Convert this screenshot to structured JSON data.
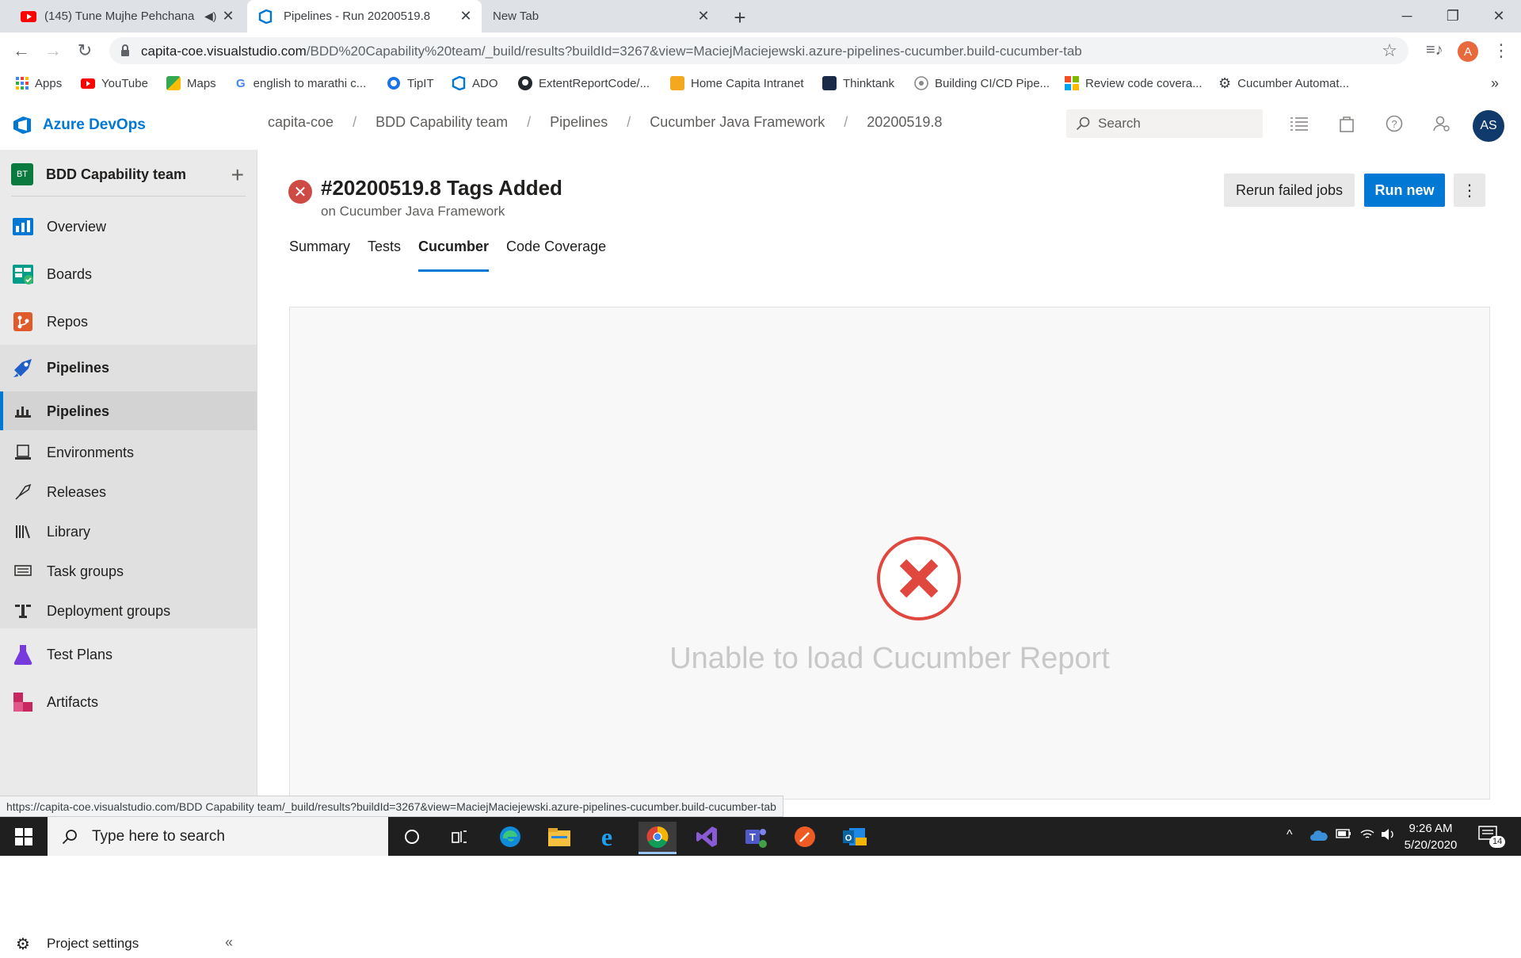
{
  "browser": {
    "tabs": [
      {
        "title": "(145) Tune Mujhe Pehchana"
      },
      {
        "title": "Pipelines - Run 20200519.8"
      },
      {
        "title": "New Tab"
      }
    ],
    "url_main": "capita-coe.visualstudio.com",
    "url_rest": "/BDD%20Capability%20team/_build/results?buildId=3267&view=MaciejMaciejewski.azure-pipelines-cucumber.build-cucumber-tab",
    "profile_initial": "A",
    "bookmarks": [
      {
        "label": "Apps"
      },
      {
        "label": "YouTube"
      },
      {
        "label": "Maps"
      },
      {
        "label": "english to marathi c..."
      },
      {
        "label": "TipIT"
      },
      {
        "label": "ADO"
      },
      {
        "label": "ExtentReportCode/..."
      },
      {
        "label": "Home Capita Intranet"
      },
      {
        "label": "Thinktank"
      },
      {
        "label": "Building CI/CD Pipe..."
      },
      {
        "label": "Review code covera..."
      },
      {
        "label": "Cucumber Automat..."
      }
    ],
    "more_bookmarks": "»",
    "status_url": "https://capita-coe.visualstudio.com/BDD Capability team/_build/results?buildId=3267&view=MaciejMaciejewski.azure-pipelines-cucumber.build-cucumber-tab"
  },
  "header": {
    "brand": "Azure DevOps",
    "breadcrumb": [
      "capita-coe",
      "BDD Capability team",
      "Pipelines",
      "Cucumber Java Framework",
      "20200519.8"
    ],
    "breadcrumb_sep": "/",
    "search_placeholder": "Search",
    "avatar": "AS"
  },
  "sidebar": {
    "project_badge": "BT",
    "project_name": "BDD Capability team",
    "items": [
      {
        "label": "Overview"
      },
      {
        "label": "Boards"
      },
      {
        "label": "Repos"
      },
      {
        "label": "Pipelines"
      }
    ],
    "sub_items": [
      {
        "label": "Pipelines"
      },
      {
        "label": "Environments"
      },
      {
        "label": "Releases"
      },
      {
        "label": "Library"
      },
      {
        "label": "Task groups"
      },
      {
        "label": "Deployment groups"
      }
    ],
    "items_after": [
      {
        "label": "Test Plans"
      },
      {
        "label": "Artifacts"
      }
    ],
    "settings_label": "Project settings"
  },
  "run": {
    "title": "#20200519.8 Tags Added",
    "subtitle": "on Cucumber Java Framework",
    "rerun_label": "Rerun failed jobs",
    "run_new_label": "Run new",
    "tabs": [
      "Summary",
      "Tests",
      "Cucumber",
      "Code Coverage"
    ],
    "active_tab": "Cucumber",
    "error_message": "Unable to load Cucumber Report"
  },
  "taskbar": {
    "search_placeholder": "Type here to search",
    "time": "9:26 AM",
    "date": "5/20/2020",
    "notification_count": "14"
  },
  "colors": {
    "accent": "#0078d4",
    "error": "#e0473f",
    "failed_badge": "#cd4a45"
  }
}
